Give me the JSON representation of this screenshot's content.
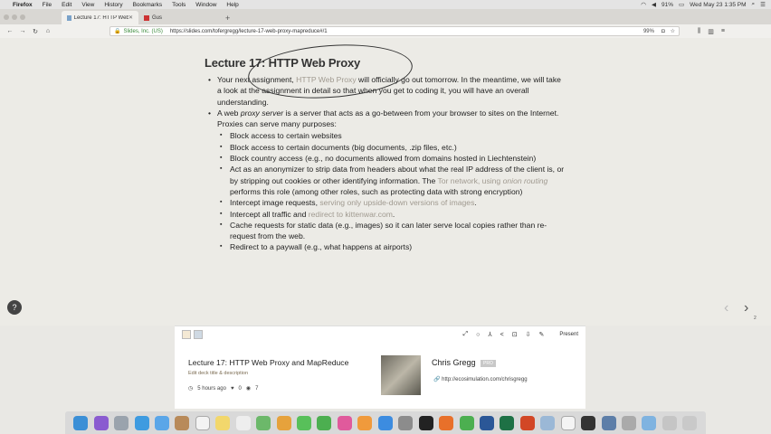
{
  "menubar": {
    "apple": "",
    "items": [
      "Firefox",
      "File",
      "Edit",
      "View",
      "History",
      "Bookmarks",
      "Tools",
      "Window",
      "Help"
    ],
    "battery": "91%",
    "datetime": "Wed May 23  1:35 PM"
  },
  "tabs": [
    {
      "label": "Lecture 17: HTTP Web Proxy",
      "active": true
    },
    {
      "label": "Gus",
      "active": false
    }
  ],
  "newtab": "+",
  "nav": {
    "site_identity": "Slides, Inc. (US)",
    "url": "https://slides.com/tofergregg/lecture-17-web-proxy-mapreduce#/1",
    "zoom": "99%"
  },
  "slide": {
    "title": "Lecture 17: HTTP Web Proxy",
    "bullets": {
      "b1_pre": "Your next assignment, ",
      "b1_link": "HTTP Web Proxy",
      "b1_post": " will officially go out tomorrow. In the meantime, we will take a look at the assignment in detail so that when you get to coding it, you will have an overall understanding.",
      "b2_pre": "A web ",
      "b2_em": "proxy server",
      "b2_post": " is a server that acts as a go-between from your browser to sites on the Internet. Proxies can serve many purposes:"
    },
    "sub": {
      "s1": "Block access to certain websites",
      "s2": "Block access to certain documents (big documents, .zip files, etc.)",
      "s3": "Block country access (e.g., no documents allowed from domains hosted in Liechtenstein)",
      "s4_pre": "Act as an anonymizer to strip data from headers about what the real IP address of the client is, or by stripping out cookies or other identifying information. The ",
      "s4_link1": "Tor network",
      "s4_mid": ", using ",
      "s4_link2": "onion routing",
      "s4_post": " performs this role (among other roles, such as protecting data with strong encryption)",
      "s5_pre": "Intercept image requests, ",
      "s5_link": "serving only upside-down versions of images",
      "s5_post": ".",
      "s6_pre": "Intercept all traffic and ",
      "s6_link": "redirect to kittenwar.com",
      "s6_post": ".",
      "s7": "Cache requests for static data (e.g., images) so it can later serve local copies rather than re-request from the web.",
      "s8": "Redirect to a paywall (e.g., what happens at airports)"
    },
    "page_number": "2"
  },
  "panel": {
    "present": "Present",
    "deck_title": "Lecture 17: HTTP Web Proxy and MapReduce",
    "edit_link": "Edit deck title & description",
    "time_ago": "5 hours ago",
    "likes": "0",
    "views": "7",
    "author": "Chris Gregg",
    "author_badge": "PRO",
    "author_url": "http://ecosimulation.com/chrisgregg"
  },
  "colors": {
    "link_muted": "#a09a90",
    "slide_bg": "#ecebe6"
  }
}
